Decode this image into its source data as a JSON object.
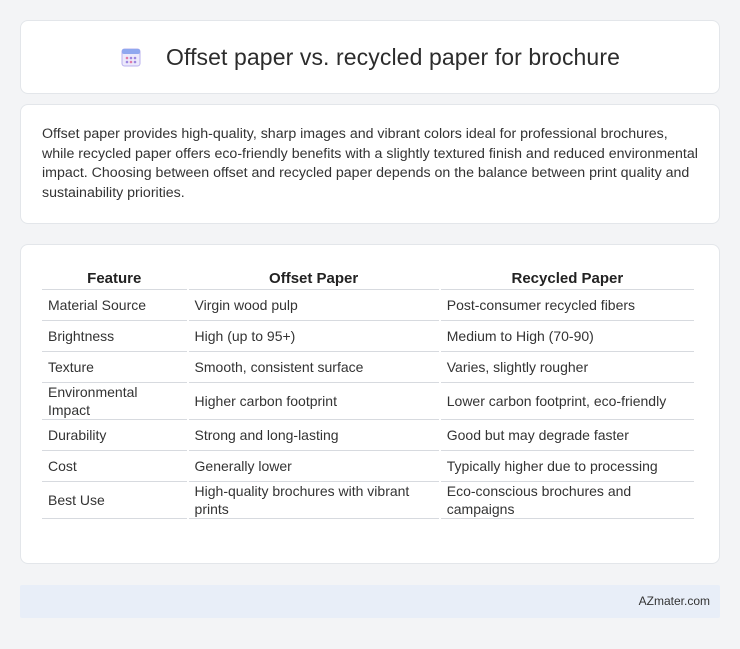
{
  "header": {
    "title": "Offset paper vs. recycled paper for brochure",
    "icon": "calendar-icon"
  },
  "summary": {
    "text": "Offset paper provides high-quality, sharp images and vibrant colors ideal for professional brochures, while recycled paper offers eco-friendly benefits with a slightly textured finish and reduced environmental impact. Choosing between offset and recycled paper depends on the balance between print quality and sustainability priorities."
  },
  "table": {
    "headers": [
      "Feature",
      "Offset Paper",
      "Recycled Paper"
    ],
    "rows": [
      [
        "Material Source",
        "Virgin wood pulp",
        "Post-consumer recycled fibers"
      ],
      [
        "Brightness",
        "High (up to 95+)",
        "Medium to High (70-90)"
      ],
      [
        "Texture",
        "Smooth, consistent surface",
        "Varies, slightly rougher"
      ],
      [
        "Environmental Impact",
        "Higher carbon footprint",
        "Lower carbon footprint, eco-friendly"
      ],
      [
        "Durability",
        "Strong and long-lasting",
        "Good but may degrade faster"
      ],
      [
        "Cost",
        "Generally lower",
        "Typically higher due to processing"
      ],
      [
        "Best Use",
        "High-quality brochures with vibrant prints",
        "Eco-conscious brochures and campaigns"
      ]
    ]
  },
  "footer": {
    "brand": "AZmater.com"
  },
  "colors": {
    "background": "#f3f4f6",
    "card": "#ffffff",
    "footer_bar": "#e8eef8",
    "icon_accent": "#8b7fd6"
  }
}
